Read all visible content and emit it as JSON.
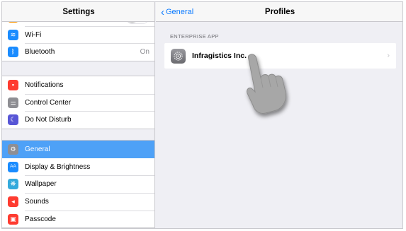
{
  "settings": {
    "title": "Settings",
    "group1": [
      {
        "label": "Wi-Fi",
        "icon": "wifi-icon",
        "color": "#1a8cff",
        "glyph": "≋",
        "value": ""
      },
      {
        "label": "Bluetooth",
        "icon": "bluetooth-icon",
        "color": "#1a8cff",
        "glyph": "ᛒ",
        "value": "On"
      }
    ],
    "group2": [
      {
        "label": "Notifications",
        "icon": "notifications-icon",
        "color": "#fe3b30",
        "glyph": "▪"
      },
      {
        "label": "Control Center",
        "icon": "control-center-icon",
        "color": "#8e8e93",
        "glyph": "⚌"
      },
      {
        "label": "Do Not Disturb",
        "icon": "do-not-disturb-icon",
        "color": "#5856d6",
        "glyph": "☾"
      }
    ],
    "group3": [
      {
        "label": "General",
        "icon": "gear-icon",
        "color": "#8e8e93",
        "glyph": "⚙",
        "selected": true
      },
      {
        "label": "Display & Brightness",
        "icon": "display-brightness-icon",
        "color": "#1a8cff",
        "glyph": "AA"
      },
      {
        "label": "Wallpaper",
        "icon": "wallpaper-icon",
        "color": "#34aadc",
        "glyph": "❋"
      },
      {
        "label": "Sounds",
        "icon": "sounds-icon",
        "color": "#fe3b30",
        "glyph": "◂"
      },
      {
        "label": "Passcode",
        "icon": "passcode-icon",
        "color": "#fe3b30",
        "glyph": "▣"
      }
    ]
  },
  "profiles": {
    "back_label": "General",
    "title": "Profiles",
    "section_label": "ENTERPRISE APP",
    "item": {
      "name": "Infragistics Inc.",
      "icon": "settings-gear-icon"
    }
  },
  "colors": {
    "accent": "#0a7aff",
    "selection": "#4ea1f7",
    "background": "#efeff4"
  }
}
